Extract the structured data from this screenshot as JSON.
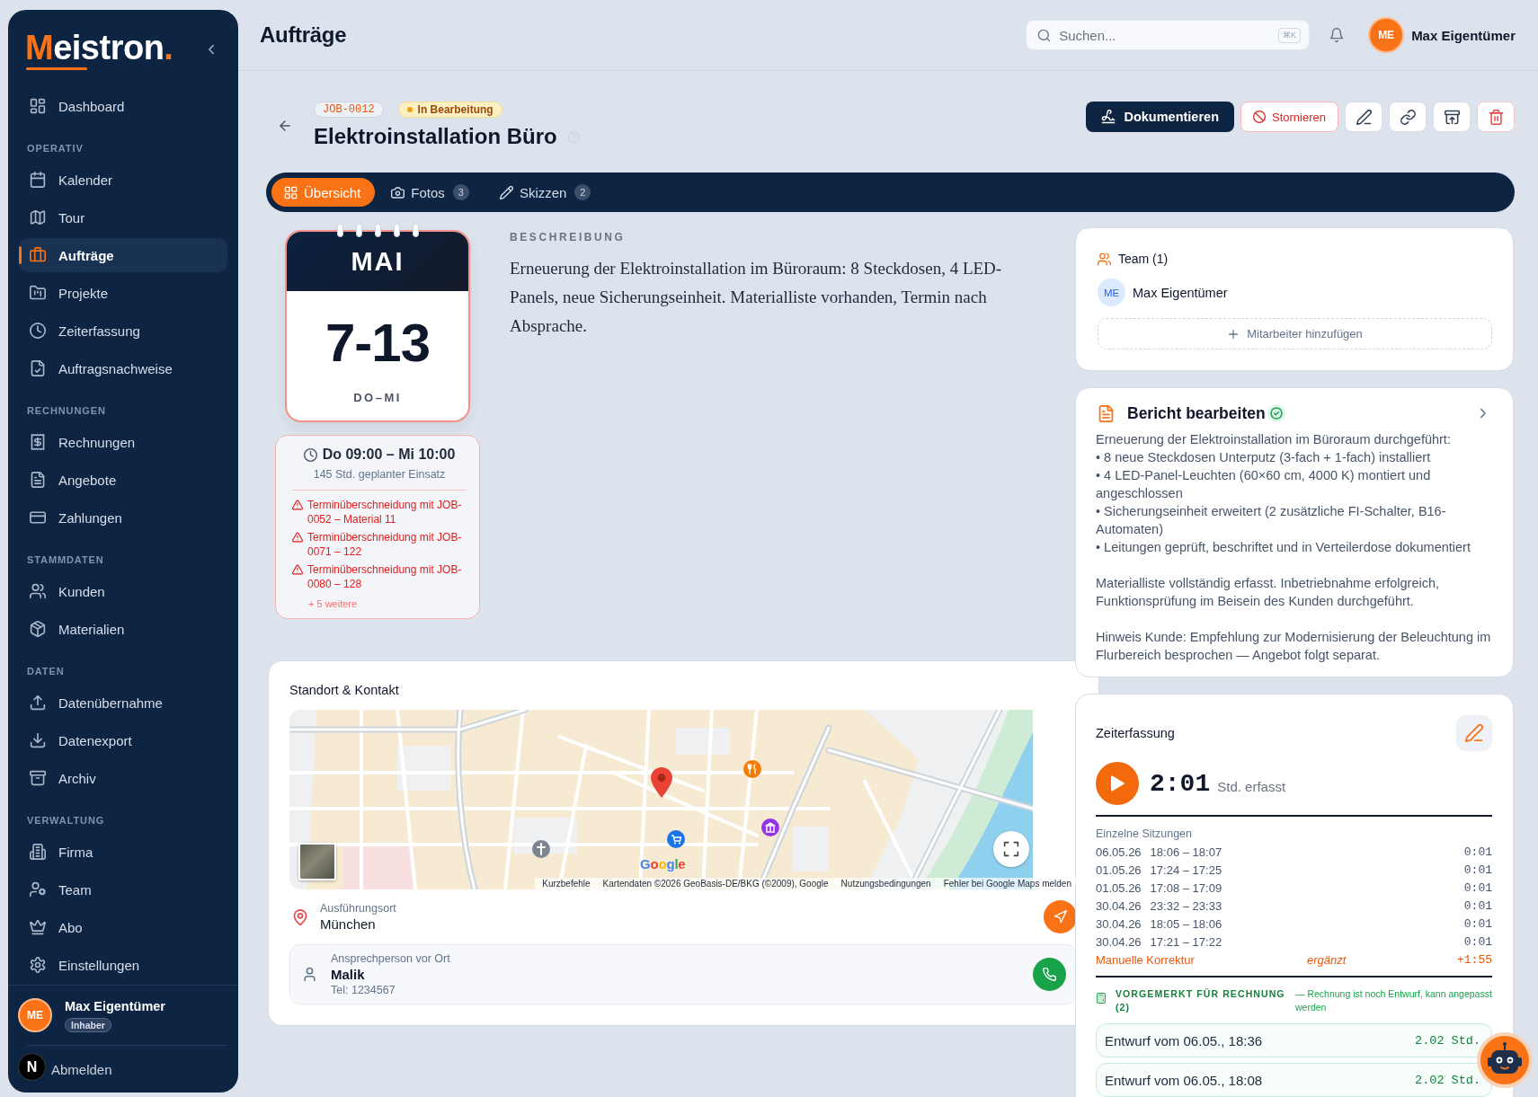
{
  "sidebar": {
    "logo": "Meistron.",
    "sections": [
      {
        "items": [
          {
            "label": "Dashboard",
            "selected": false
          }
        ]
      },
      {
        "title": "OPERATIV",
        "items": [
          {
            "label": "Kalender",
            "selected": false
          },
          {
            "label": "Tour",
            "selected": false
          },
          {
            "label": "Aufträge",
            "selected": true
          },
          {
            "label": "Projekte",
            "selected": false
          },
          {
            "label": "Zeiterfassung",
            "selected": false
          },
          {
            "label": "Auftragsnachweise",
            "selected": false
          }
        ]
      },
      {
        "title": "RECHNUNGEN",
        "items": [
          {
            "label": "Rechnungen",
            "selected": false
          },
          {
            "label": "Angebote",
            "selected": false
          },
          {
            "label": "Zahlungen",
            "selected": false
          }
        ]
      },
      {
        "title": "STAMMDATEN",
        "items": [
          {
            "label": "Kunden",
            "selected": false
          },
          {
            "label": "Materialien",
            "selected": false
          }
        ]
      },
      {
        "title": "DATEN",
        "items": [
          {
            "label": "Datenübernahme",
            "selected": false
          },
          {
            "label": "Datenexport",
            "selected": false
          },
          {
            "label": "Archiv",
            "selected": false
          }
        ]
      },
      {
        "title": "VERWALTUNG",
        "items": [
          {
            "label": "Firma",
            "selected": false
          },
          {
            "label": "Team",
            "selected": false
          },
          {
            "label": "Abo",
            "selected": false
          },
          {
            "label": "Einstellungen",
            "selected": false
          }
        ]
      }
    ],
    "user": {
      "initials": "ME",
      "name": "Max Eigentümer",
      "role": "Inhaber"
    },
    "logout": "Abmelden"
  },
  "dev_indicator": "N",
  "header": {
    "title": "Aufträge",
    "search": {
      "placeholder": "Suchen...",
      "shortcut": "⌘K"
    },
    "user": {
      "initials": "ME",
      "name": "Max Eigentümer"
    }
  },
  "job": {
    "number": "JOB-0012",
    "status": "In Bearbeitung",
    "title": "Elektroinstallation Büro",
    "actions": [
      {
        "kind": "primary",
        "label": "Dokumentieren"
      },
      {
        "kind": "danger",
        "label": "Stornieren"
      }
    ]
  },
  "tabs": [
    {
      "label": "Übersicht",
      "selected": true
    },
    {
      "label": "Fotos",
      "count": "3",
      "selected": false
    },
    {
      "label": "Skizzen",
      "count": "2",
      "selected": false
    }
  ],
  "calendar": {
    "month": "MAI",
    "days": "7-13",
    "weekdays": "DO–MI"
  },
  "schedule": {
    "range": "Do 09:00 – Mi 10:00",
    "planned": "145 Std. geplanter Einsatz",
    "conflicts": [
      "Terminüberschneidung mit JOB-0052 – Material 11",
      "Terminüberschneidung mit JOB-0071 – 122",
      "Terminüberschneidung mit JOB-0080 – 128"
    ],
    "more": "+ 5 weitere"
  },
  "description": {
    "heading": "BESCHREIBUNG",
    "text": "Erneuerung der Elektroinstallation im Büroraum: 8 Steckdosen, 4 LED-Panels, neue Sicherungseinheit. Materialliste vorhanden, Termin nach Absprache."
  },
  "location": {
    "title": "Standort & Kontakt",
    "map": {
      "logo": "Google",
      "attribution": [
        "Kurzbefehle",
        "Kartendaten ©2026 GeoBasis-DE/BKG (©2009), Google",
        "Nutzungsbedingungen",
        "Fehler bei Google Maps melden"
      ]
    },
    "place": {
      "label": "Ausführungsort",
      "value": "München"
    },
    "contact": {
      "label": "Ansprechperson vor Ort",
      "name": "Malik",
      "phone": "Tel: 1234567"
    }
  },
  "team": {
    "title": "Team (1)",
    "members": [
      {
        "initials": "ME",
        "name": "Max Eigentümer"
      }
    ],
    "add_label": "Mitarbeiter hinzufügen"
  },
  "report": {
    "title": "Bericht bearbeiten",
    "completed": true,
    "text": "Erneuerung der Elektroinstallation im Büroraum durchgeführt:\n• 8 neue Steckdosen Unterputz (3-fach + 1-fach) installiert\n• 4 LED-Panel-Leuchten (60×60 cm, 4000 K) montiert und angeschlossen\n• Sicherungseinheit erweitert (2 zusätzliche FI-Schalter, B16-Automaten)\n• Leitungen geprüft, beschriftet und in Verteilerdose dokumentiert\n\nMaterialliste vollständig erfasst. Inbetriebnahme erfolgreich, Funktionsprüfung im Beisein des Kunden durchgeführt.\n\nHinweis Kunde: Empfehlung zur Modernisierung der Beleuchtung im Flurbereich besprochen — Angebot folgt separat."
  },
  "time_tracking": {
    "title": "Zeiterfassung",
    "running": false,
    "total": "2:01",
    "unit": "Std. erfasst",
    "sessions_label": "Einzelne Sitzungen",
    "sessions": [
      {
        "date": "06.05.26",
        "time": "18:06 – 18:07",
        "duration": "0:01"
      },
      {
        "date": "01.05.26",
        "time": "17:24 – 17:25",
        "duration": "0:01"
      },
      {
        "date": "01.05.26",
        "time": "17:08 – 17:09",
        "duration": "0:01"
      },
      {
        "date": "30.04.26",
        "time": "23:32 – 23:33",
        "duration": "0:01"
      },
      {
        "date": "30.04.26",
        "time": "18:05 – 18:06",
        "duration": "0:01"
      },
      {
        "date": "30.04.26",
        "time": "17:21 – 17:22",
        "duration": "0:01"
      }
    ],
    "correction": {
      "label": "Manuelle Korrektur",
      "note": "ergänzt",
      "value": "+1:55"
    },
    "billing": {
      "title": "VORGEMERKT FÜR RECHNUNG (2)",
      "note": "— Rechnung ist noch Entwurf, kann angepasst werden",
      "drafts": [
        {
          "label": "Entwurf vom 06.05., 18:36",
          "hours": "2.02 Std."
        },
        {
          "label": "Entwurf vom 06.05., 18:08",
          "hours": "2.02 Std."
        }
      ]
    }
  }
}
